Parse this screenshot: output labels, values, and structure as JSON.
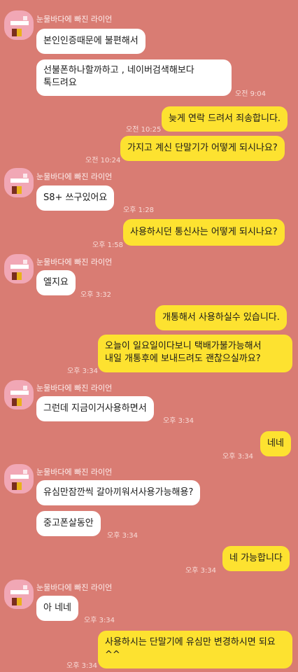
{
  "sender_name": "눈물바다에 빠진 라이언",
  "messages": [
    {
      "id": "m1",
      "side": "in",
      "text": "본인인증때문에 불편해서",
      "time": ""
    },
    {
      "id": "m2",
      "side": "in",
      "text": "선불폰하나할까하고 , 네이버검색해보다\n톡드려요",
      "time": "오전 9:04"
    },
    {
      "id": "m3",
      "side": "out",
      "text": "늦게 연락 드려서 죄송합니다.",
      "time": "오전 10:25"
    },
    {
      "id": "m4",
      "side": "out",
      "text": "가지고 계신 단말기가 어떻게 되시나요?",
      "time": "오전 10:24"
    },
    {
      "id": "m5",
      "side": "in",
      "text": "S8+ 쓰구있어요",
      "time": "오후 1:28"
    },
    {
      "id": "m6",
      "side": "out",
      "text": "사용하시던 통신사는 어떻게 되시나요?",
      "time": "오후 1:58"
    },
    {
      "id": "m7",
      "side": "in",
      "text": "엘지요",
      "time": "오후 3:32"
    },
    {
      "id": "m8",
      "side": "out",
      "text": "개통해서 사용하실수 있습니다.",
      "time": ""
    },
    {
      "id": "m9",
      "side": "out",
      "text": "오늘이 일요일이다보니 택배가불가능해서\n내일 개통후에 보내드려도 괜찮으실까요?",
      "time": "오후 3:34"
    },
    {
      "id": "m10",
      "side": "in",
      "text": "그런데 지금이거사용하면서",
      "time": "오후 3:34"
    },
    {
      "id": "m11",
      "side": "out",
      "text": "네네",
      "time": "오후 3:34"
    },
    {
      "id": "m12",
      "side": "in",
      "text": "유심만잠깐씩 갈아끼워서사용가능해용?",
      "time": ""
    },
    {
      "id": "m13",
      "side": "in",
      "text": "중고폰살동안",
      "time": "오후 3:34"
    },
    {
      "id": "m14",
      "side": "out",
      "text": "네 가능합니다",
      "time": "오후 3:34"
    },
    {
      "id": "m15",
      "side": "in",
      "text": "아 네네",
      "time": "오후 3:34"
    },
    {
      "id": "m16",
      "side": "out",
      "text": "사용하시는 단말기에 유심만 변경하시면 되요\n^^",
      "time": "오후 3:34"
    }
  ]
}
